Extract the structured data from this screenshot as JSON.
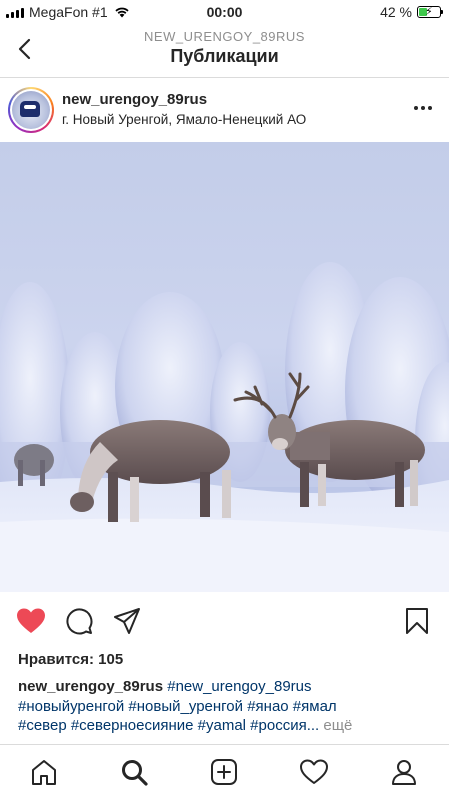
{
  "status_bar": {
    "carrier": "MegaFon #1",
    "time": "00:00",
    "battery_percent": "42 %",
    "battery_level": 0.42,
    "wifi_icon": "wifi-icon",
    "charging_icon": "bolt-icon"
  },
  "header": {
    "subtitle": "NEW_URENGOY_89RUS",
    "title": "Публикации",
    "back_icon": "chevron-left-icon"
  },
  "post": {
    "username": "new_urengoy_89rus",
    "location": "г. Новый Уренгой, Ямало-Ненецкий АО",
    "more_icon": "more-horizontal-icon",
    "image_subject": "reindeer in snowy forest",
    "actions": {
      "like_icon": "heart-filled-icon",
      "like_color": "#ed4956",
      "comment_icon": "comment-icon",
      "share_icon": "send-icon",
      "save_icon": "bookmark-icon"
    },
    "likes_text": "Нравится: 105",
    "caption": {
      "author": "new_urengoy_89rus",
      "line1_tag": "#new_urengoy_89rus",
      "line2": "#новыйуренгой #новый_уренгой #янао #ямал",
      "line3": "#север #северноесияние #yamal #россия...",
      "more_label": "ещё"
    }
  },
  "tab_bar": {
    "items": [
      {
        "name": "home",
        "icon": "home-icon"
      },
      {
        "name": "search",
        "icon": "search-icon"
      },
      {
        "name": "new-post",
        "icon": "add-square-icon"
      },
      {
        "name": "activity",
        "icon": "heart-outline-icon"
      },
      {
        "name": "profile",
        "icon": "profile-icon"
      }
    ]
  },
  "colors": {
    "text": "#262626",
    "hashtag": "#003569",
    "muted": "#8e8e8e",
    "divider": "#dbdbdb"
  }
}
